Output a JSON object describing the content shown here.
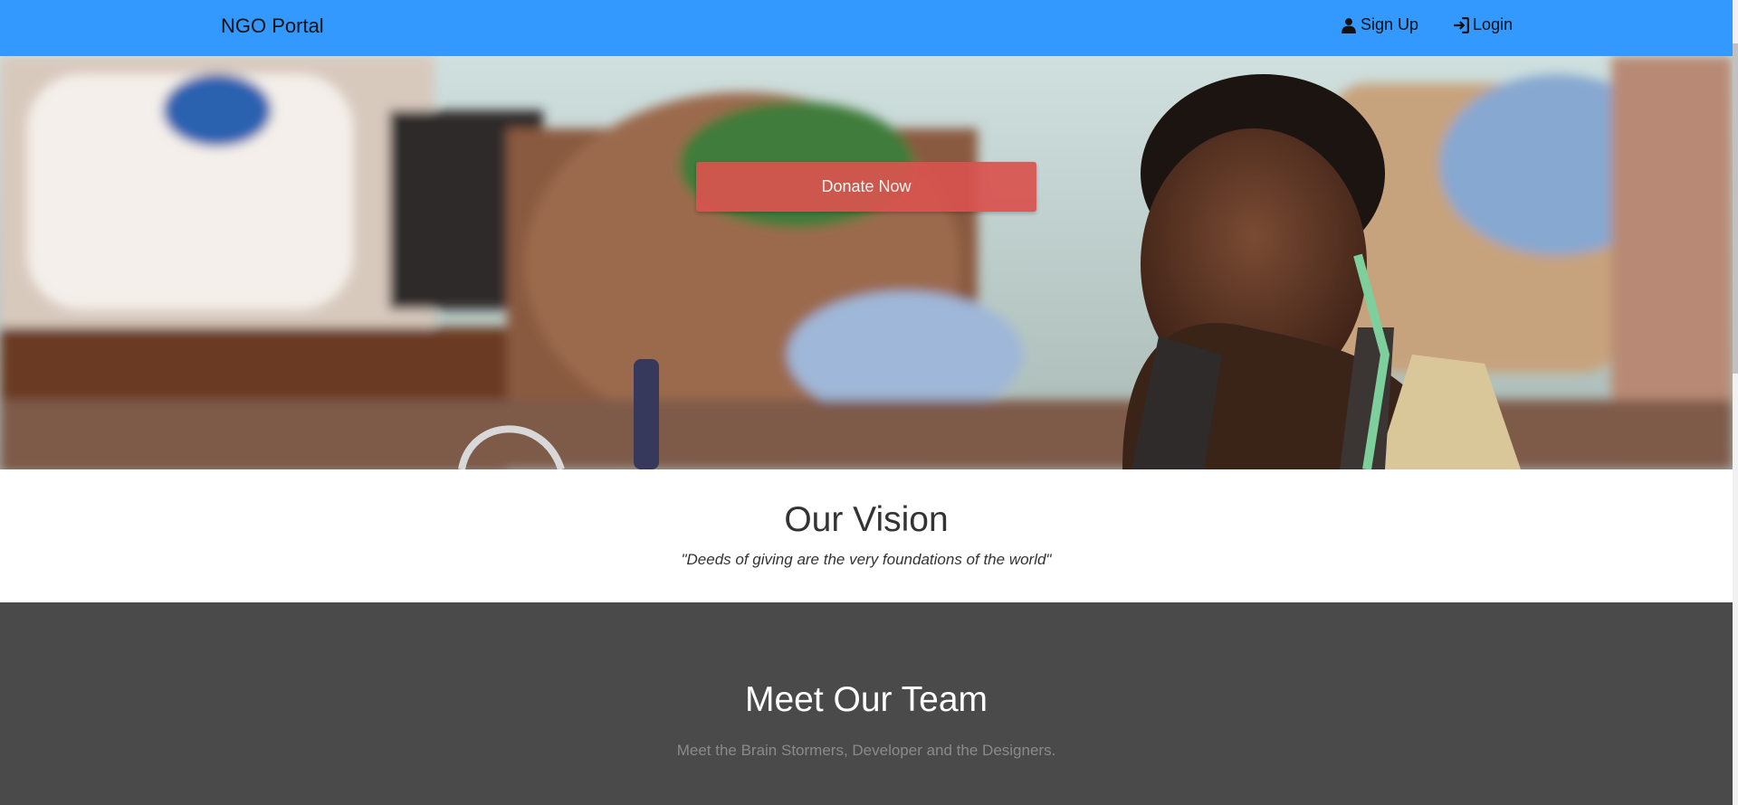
{
  "navbar": {
    "brand": "NGO Portal",
    "signup_label": "Sign Up",
    "login_label": "Login",
    "signup_icon": "user-icon",
    "login_icon": "login-icon",
    "color": "#3399ff"
  },
  "hero": {
    "donate_label": "Donate Now",
    "donate_color": "#d9534f"
  },
  "vision": {
    "title": "Our Vision",
    "quote": "\"Deeds of giving are the very foundations of the world\""
  },
  "team": {
    "title": "Meet Our Team",
    "subtitle": "Meet the Brain Stormers, Developer and the Designers."
  }
}
